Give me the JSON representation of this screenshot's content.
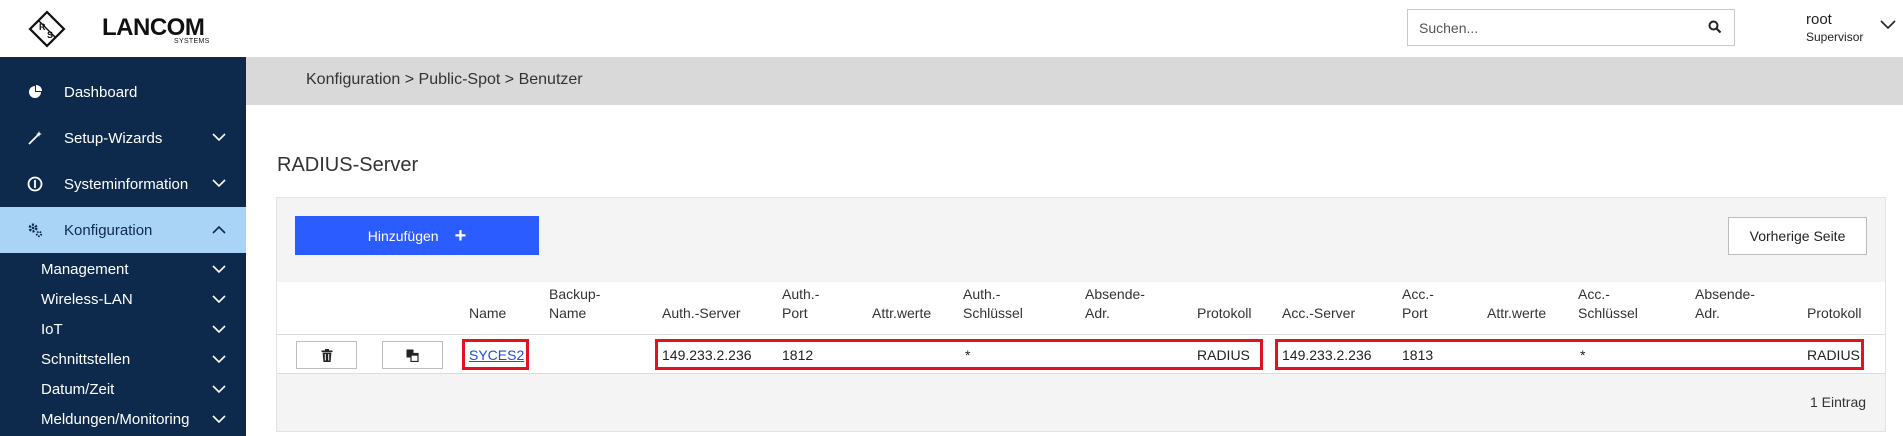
{
  "brand": {
    "name": "LANCOM",
    "sub": "SYSTEMS",
    "mark": "R&S"
  },
  "search": {
    "placeholder": "Suchen...",
    "value": ""
  },
  "user": {
    "name": "root",
    "role": "Supervisor"
  },
  "sidebar": {
    "items": [
      {
        "label": "Dashboard",
        "icon": "dashboard-icon",
        "expandable": false,
        "active": false
      },
      {
        "label": "Setup-Wizards",
        "icon": "wand-icon",
        "expandable": true,
        "active": false
      },
      {
        "label": "Systeminformation",
        "icon": "info-icon",
        "expandable": true,
        "active": false
      },
      {
        "label": "Konfiguration",
        "icon": "gears-icon",
        "expandable": true,
        "active": true
      }
    ],
    "subitems": [
      {
        "label": "Management"
      },
      {
        "label": "Wireless-LAN"
      },
      {
        "label": "IoT"
      },
      {
        "label": "Schnittstellen"
      },
      {
        "label": "Datum/Zeit"
      },
      {
        "label": "Meldungen/Monitoring"
      }
    ]
  },
  "breadcrumb": "Konfiguration > Public-Spot > Benutzer",
  "section_title": "RADIUS-Server",
  "buttons": {
    "add": "Hinzufügen",
    "previous": "Vorherige Seite"
  },
  "table": {
    "headers": {
      "name": "Name",
      "backup_name_1": "Backup-",
      "backup_name_2": "Name",
      "auth_server": "Auth.-Server",
      "auth_port_1": "Auth.-",
      "auth_port_2": "Port",
      "auth_attr": "Attr.werte",
      "auth_key_1": "Auth.-",
      "auth_key_2": "Schlüssel",
      "auth_src_1": "Absende-",
      "auth_src_2": "Adr.",
      "auth_proto": "Protokoll",
      "acc_server": "Acc.-Server",
      "acc_port_1": "Acc.-",
      "acc_port_2": "Port",
      "acc_attr": "Attr.werte",
      "acc_key_1": "Acc.-",
      "acc_key_2": "Schlüssel",
      "acc_src_1": "Absende-",
      "acc_src_2": "Adr.",
      "acc_proto": "Protokoll"
    },
    "rows": [
      {
        "name": "SYCES2",
        "backup_name": "",
        "auth_server": "149.233.2.236",
        "auth_port": "1812",
        "auth_attr": "",
        "auth_key": "*",
        "auth_src": "",
        "auth_proto": "RADIUS",
        "acc_server": "149.233.2.236",
        "acc_port": "1813",
        "acc_attr": "",
        "acc_key": "*",
        "acc_src": "",
        "acc_proto": "RADIUS"
      }
    ],
    "count": "1 Eintrag"
  },
  "colors": {
    "sidebar_bg": "#0d2a4c",
    "sidebar_active": "#a9d4f5",
    "primary_button": "#2b5cff",
    "highlight": "#e0141e",
    "link": "#1a4fd6"
  }
}
